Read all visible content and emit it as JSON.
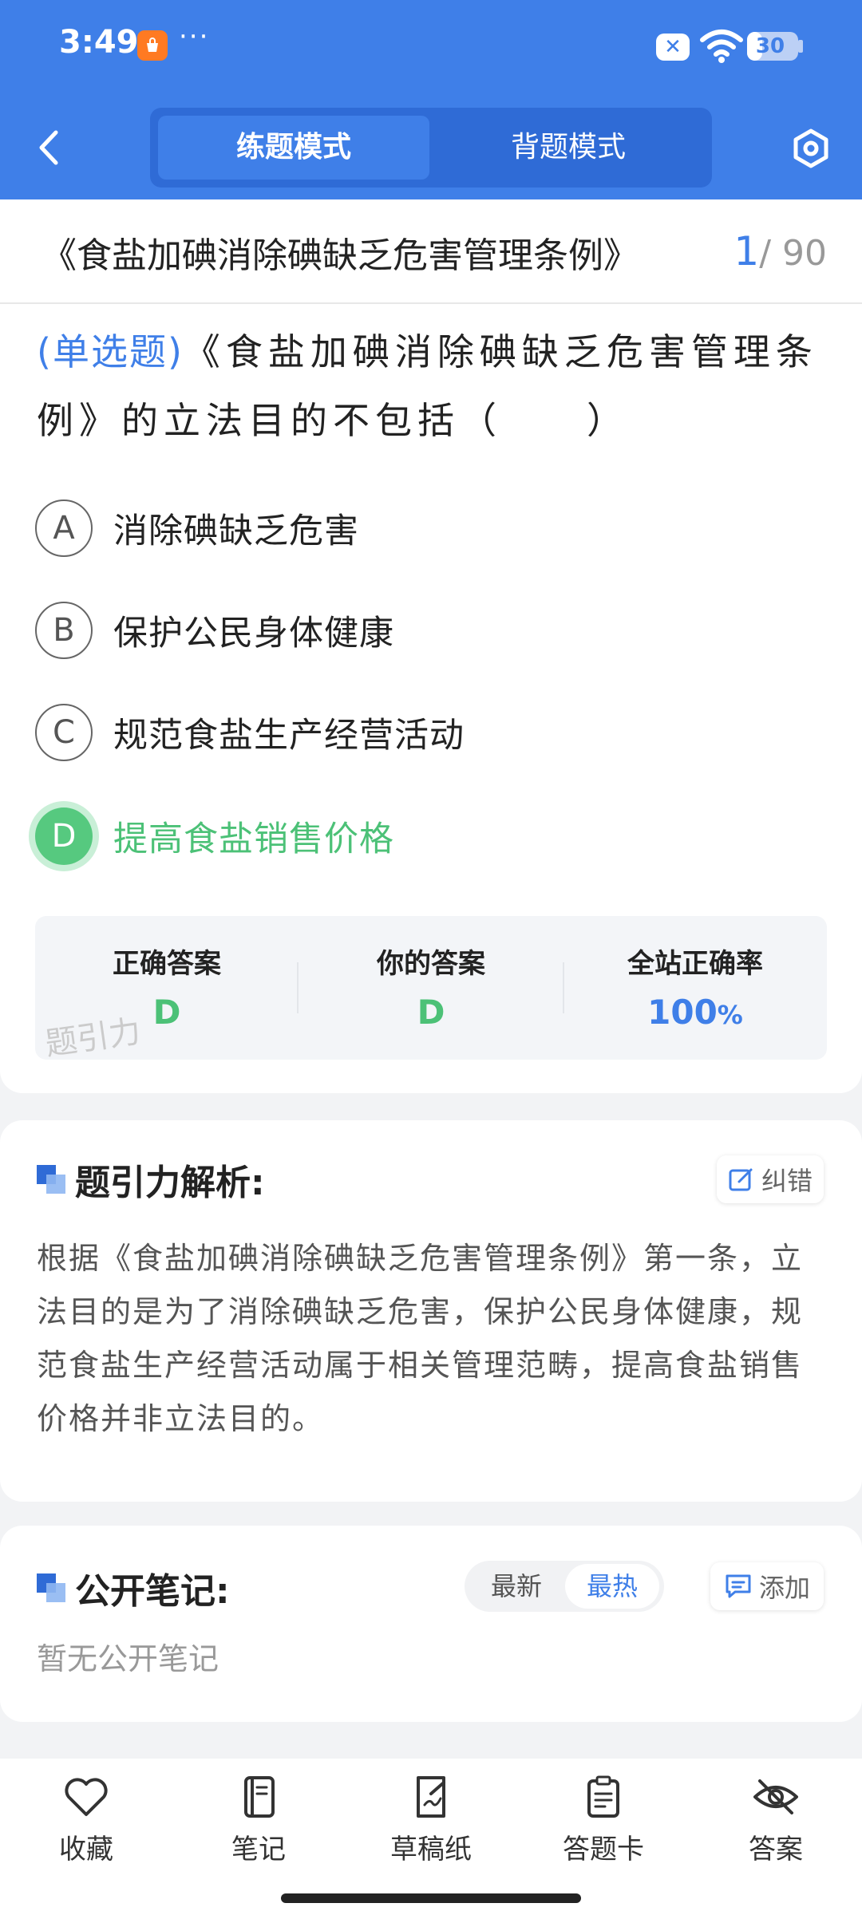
{
  "status_bar": {
    "time": "3:49",
    "dots": "···",
    "battery": "30",
    "battery_level": 0.3,
    "icons": [
      "app-badge-icon",
      "close-icon",
      "wifi-icon",
      "battery-icon"
    ]
  },
  "header": {
    "back_icon": "chevron-left-icon",
    "tabs": [
      {
        "label": "练题模式",
        "active": true
      },
      {
        "label": "背题模式",
        "active": false
      }
    ],
    "settings_icon": "hexagon-settings-icon"
  },
  "question": {
    "doc_title": "《食盐加碘消除碘缺乏危害管理条例》",
    "current": "1",
    "total": "/ 90",
    "type_label": "(单选题)",
    "stem": "《食盐加碘消除碘缺乏危害管理条例》的立法目的不包括（　　）",
    "options": [
      {
        "letter": "A",
        "text": "消除碘缺乏危害"
      },
      {
        "letter": "B",
        "text": "保护公民身体健康"
      },
      {
        "letter": "C",
        "text": "规范食盐生产经营活动"
      },
      {
        "letter": "D",
        "text": "提高食盐销售价格"
      }
    ],
    "correct_letter": "D"
  },
  "stats": {
    "correct_label": "正确答案",
    "correct_value": "D",
    "yours_label": "你的答案",
    "yours_value": "D",
    "rate_label": "全站正确率",
    "rate_value": "100",
    "rate_unit": "%",
    "watermark": "题引力",
    "colors": {
      "correct": "#4cc177",
      "rate": "#3f7fe8"
    }
  },
  "analysis": {
    "title": "题引力解析:",
    "correct_btn": "纠错",
    "text": "根据《食盐加碘消除碘缺乏危害管理条例》第一条，立法目的是为了消除碘缺乏危害，保护公民身体健康，规范食盐生产经营活动属于相关管理范畴，提高食盐销售价格并非立法目的。"
  },
  "notes": {
    "title": "公开笔记:",
    "sort_latest": "最新",
    "sort_hot": "最热",
    "add_btn": "添加",
    "empty": "暂无公开笔记"
  },
  "bottom_nav": [
    {
      "label": "收藏",
      "icon": "heart-icon"
    },
    {
      "label": "笔记",
      "icon": "notebook-icon"
    },
    {
      "label": "草稿纸",
      "icon": "draft-paper-icon"
    },
    {
      "label": "答题卡",
      "icon": "answer-card-icon"
    },
    {
      "label": "答案",
      "icon": "eye-off-icon"
    }
  ],
  "theme": {
    "primary": "#3f7fe8",
    "success": "#56c97f"
  }
}
